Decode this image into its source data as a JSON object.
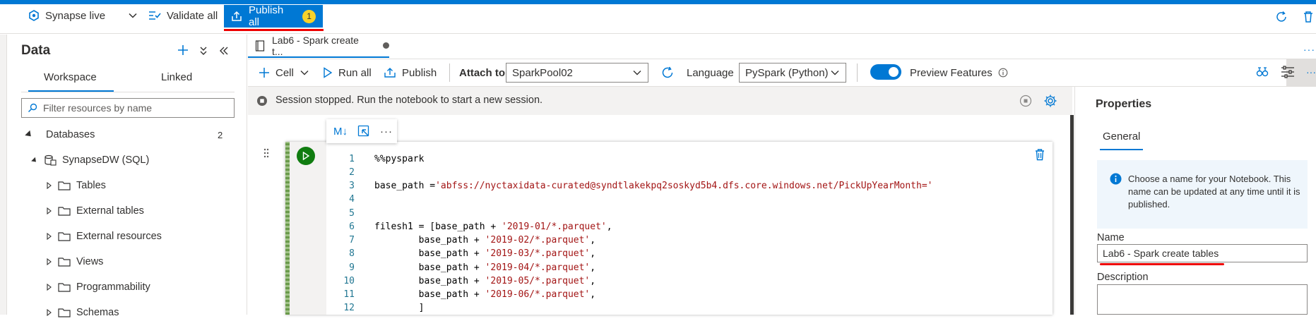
{
  "topbar": {
    "mode_label": "Synapse live",
    "validate_label": "Validate all",
    "publish_label": "Publish all",
    "publish_count": "1"
  },
  "left_panel": {
    "title": "Data",
    "tabs": [
      "Workspace",
      "Linked"
    ],
    "active_tab": "Workspace",
    "filter_placeholder": "Filter resources by name",
    "databases_label": "Databases",
    "databases_count": "2",
    "database_name": "SynapseDW (SQL)",
    "folders": [
      "Tables",
      "External tables",
      "External resources",
      "Views",
      "Programmability",
      "Schemas"
    ]
  },
  "notebook": {
    "tab_title": "Lab6 - Spark create t...",
    "toolbar": {
      "cell_label": "Cell",
      "run_all_label": "Run all",
      "publish_label": "Publish",
      "attach_label": "Attach to",
      "attach_value": "SparkPool02",
      "language_label": "Language",
      "language_value": "PySpark (Python)",
      "preview_label": "Preview Features",
      "preview_enabled": true
    },
    "session_message": "Session stopped. Run the notebook to start a new session.",
    "cell_toolbar": {
      "markdown_label": "M↓"
    },
    "line_numbers": [
      "1",
      "2",
      "3",
      "4",
      "5",
      "6",
      "7",
      "8",
      "9",
      "10",
      "11",
      "12"
    ],
    "code": {
      "l1": "%%pyspark",
      "l3_a": "base_path =",
      "l3_b": "'abfss://nyctaxidata-curated@syndtlakekpq2soskyd5b4.dfs.core.windows.net/PickUpYearMonth='",
      "l6_a": "filesh1 = [base_path + ",
      "l6_b": "'2019-01/*.parquet'",
      "l6_c": ",",
      "l7_a": "        base_path + ",
      "l7_b": "'2019-02/*.parquet'",
      "l7_c": ",",
      "l8_a": "        base_path + ",
      "l8_b": "'2019-03/*.parquet'",
      "l8_c": ",",
      "l9_a": "        base_path + ",
      "l9_b": "'2019-04/*.parquet'",
      "l9_c": ",",
      "l10_a": "        base_path + ",
      "l10_b": "'2019-05/*.parquet'",
      "l10_c": ",",
      "l11_a": "        base_path + ",
      "l11_b": "'2019-06/*.parquet'",
      "l11_c": ",",
      "l12": "        ]"
    }
  },
  "properties": {
    "title": "Properties",
    "tab": "General",
    "info": "Choose a name for your Notebook. This name can be updated at any time until it is published.",
    "name_label": "Name",
    "name_value": "Lab6 - Spark create tables",
    "description_label": "Description"
  },
  "colors": {
    "accent": "#0078d4",
    "badge": "#f8d22a",
    "run_green": "#107c10",
    "highlight_red": "#e00000"
  }
}
